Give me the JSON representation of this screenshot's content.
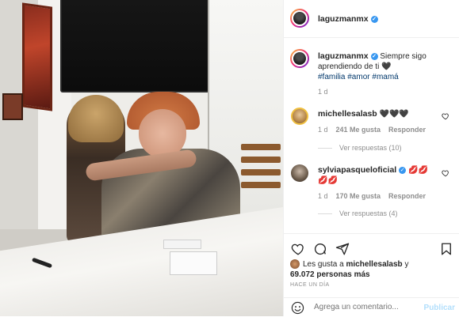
{
  "post": {
    "author": "laguzmanmx",
    "caption_text": "Siempre sigo aprendiendo de ti",
    "caption_emoji": "🖤",
    "hashtags": [
      "#familia",
      "#amor",
      "#mamá"
    ],
    "caption_time": "1 d"
  },
  "comments": [
    {
      "user": "michellesalasb",
      "text": "🖤🖤🖤",
      "time": "1 d",
      "likes": "241 Me gusta",
      "reply": "Responder",
      "view_replies": "Ver respuestas (10)"
    },
    {
      "user": "sylviapasqueloficial",
      "text": "💋💋💋💋",
      "time": "1 d",
      "likes": "170 Me gusta",
      "reply": "Responder",
      "view_replies": "Ver respuestas (4)"
    }
  ],
  "likes_summary": {
    "prefix": "Les gusta a",
    "user": "michellesalasb",
    "connector": "y",
    "count": "69.072 personas más"
  },
  "timestamp": "HACE UN DÍA",
  "add_comment": {
    "placeholder": "Agrega un comentario...",
    "publish": "Publicar"
  },
  "colors": {
    "verified": "#3897f0",
    "hashtag": "#00376b",
    "muted": "#8e8e8e",
    "publish_disabled": "#b2dffc"
  },
  "icons": [
    "heart-icon",
    "comment-icon",
    "share-icon",
    "bookmark-icon",
    "emoji-icon",
    "verified-icon"
  ]
}
